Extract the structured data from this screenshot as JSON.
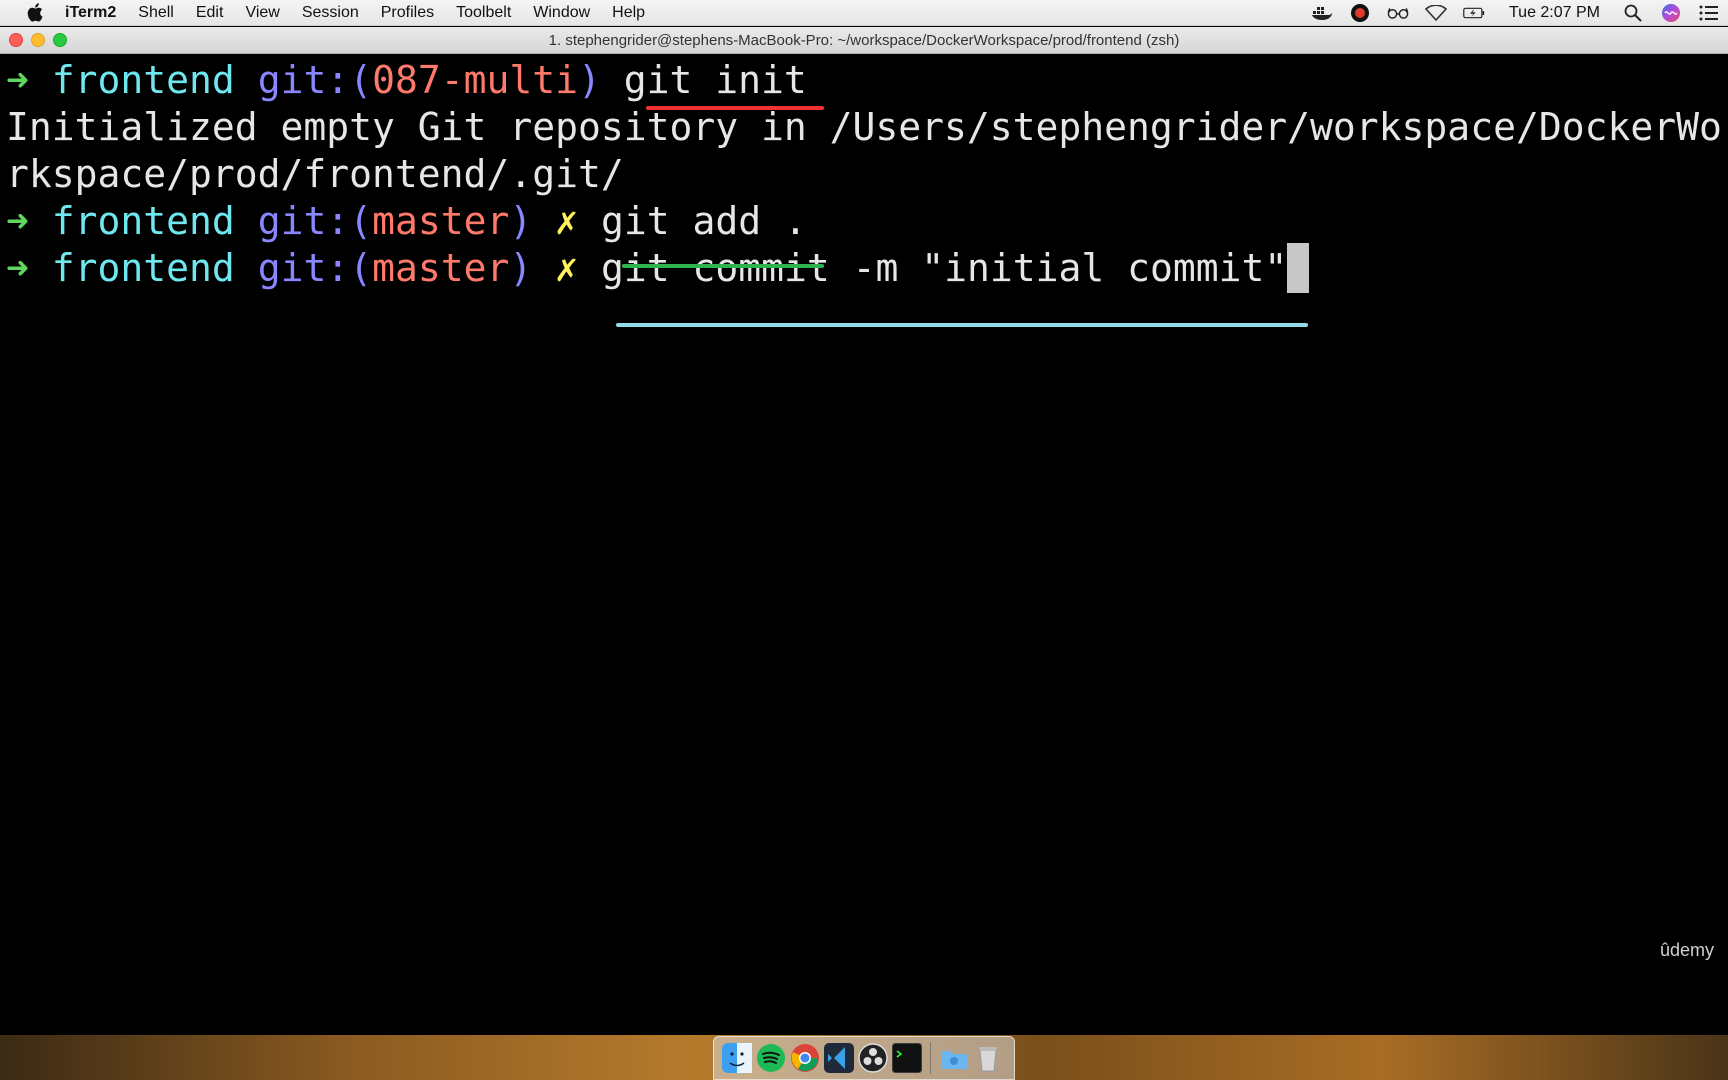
{
  "menubar": {
    "app_name": "iTerm2",
    "items": [
      "Shell",
      "Edit",
      "View",
      "Session",
      "Profiles",
      "Toolbelt",
      "Window",
      "Help"
    ],
    "clock": "Tue 2:07 PM",
    "status_icons": [
      "docker-icon",
      "creative-cloud-icon",
      "reading-glasses-icon",
      "wifi-icon",
      "battery-icon",
      "spotlight-search-icon",
      "siri-icon",
      "notification-center-icon"
    ]
  },
  "window": {
    "title": "1. stephengrider@stephens-MacBook-Pro: ~/workspace/DockerWorkspace/prod/frontend (zsh)"
  },
  "terminal": {
    "line1": {
      "arrow": "➜",
      "dir": "frontend",
      "git_open": "git:(",
      "branch": "087-multi",
      "git_close": ")",
      "cmd": "git init"
    },
    "output1": "Initialized empty Git repository in /Users/stephengrider/workspace/DockerWo",
    "output2": "rkspace/prod/frontend/.git/",
    "line2": {
      "arrow": "➜",
      "dir": "frontend",
      "git_open": "git:(",
      "branch": "master",
      "git_close": ")",
      "dirty": "✗",
      "cmd": "git add ."
    },
    "line3": {
      "arrow": "➜",
      "dir": "frontend",
      "git_open": "git:(",
      "branch": "master",
      "git_close": ")",
      "dirty": "✗",
      "cmd": "git commit -m \"initial commit\""
    },
    "highlight_colors": {
      "git_init": "#f23232",
      "git_add": "#2fb34e",
      "git_commit": "#8fdbe6"
    }
  },
  "watermark": "ûdemy",
  "dock": {
    "apps": [
      "finder-icon",
      "spotify-icon",
      "chrome-icon",
      "vscode-icon",
      "obs-icon",
      "terminal-icon"
    ],
    "folders": [
      "downloads-folder-icon",
      "trash-icon"
    ]
  }
}
